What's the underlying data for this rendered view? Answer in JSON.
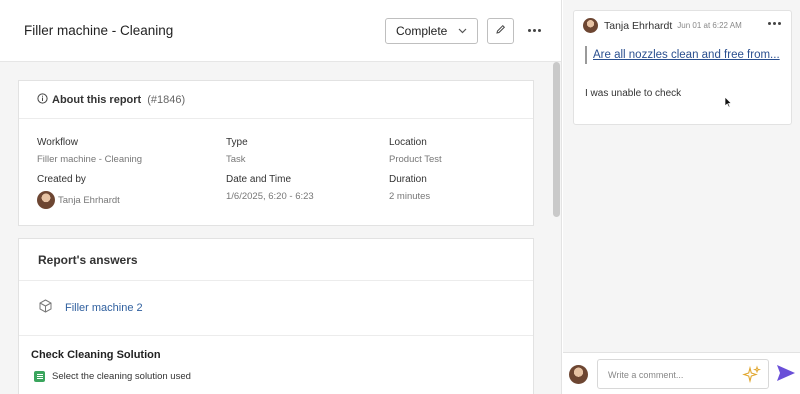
{
  "header": {
    "title": "Filler machine - Cleaning",
    "status": "Complete"
  },
  "about": {
    "title": "About this report",
    "report_id": "(#1846)",
    "workflow_label": "Workflow",
    "workflow_value": "Filler machine - Cleaning",
    "type_label": "Type",
    "type_value": "Task",
    "location_label": "Location",
    "location_value": "Product Test",
    "created_by_label": "Created by",
    "created_by_value": "Tanja Ehrhardt",
    "datetime_label": "Date and Time",
    "datetime_value": "1/6/2025, 6:20 - 6:23",
    "duration_label": "Duration",
    "duration_value": "2 minutes"
  },
  "answers": {
    "title": "Report's answers",
    "machine_link": "Filler machine 2",
    "section_title": "Check Cleaning Solution",
    "question": "Select the cleaning solution used"
  },
  "comment": {
    "author": "Tanja Ehrhardt",
    "time": "Jun 01 at 6:22 AM",
    "quote_link": "Are all nozzles clean and free from...",
    "body": "I was unable to check"
  },
  "composer": {
    "placeholder": "Write a comment..."
  },
  "colors": {
    "link": "#2f5f9e",
    "send": "#6a4fd8",
    "question_icon": "#3aa55d"
  }
}
